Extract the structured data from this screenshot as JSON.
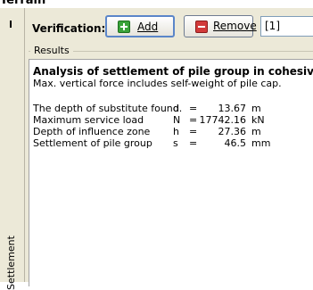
{
  "window": {
    "title_fragment": "Terrain"
  },
  "side_tab": {
    "label": "Settlement"
  },
  "toolbar": {
    "verification_label": "Verification:",
    "add_label": "Add",
    "remove_label": "Remove",
    "index_value": "[1]"
  },
  "results": {
    "legend": "Results",
    "title": "Analysis of settlement of pile group in cohesive soils",
    "subtitle": "Max. vertical force includes self-weight of pile cap.",
    "rows": [
      {
        "label": "The depth of substitute found.",
        "symbol": "d",
        "eq": "=",
        "value": "13.67",
        "unit": "m"
      },
      {
        "label": "Maximum service load",
        "symbol": "N",
        "eq": "=",
        "value": "17742.16",
        "unit": "kN"
      },
      {
        "label": "Depth of influence zone",
        "symbol": "h",
        "eq": "=",
        "value": "27.36",
        "unit": "m"
      },
      {
        "label": "Settlement of pile group",
        "symbol": "s",
        "eq": "=",
        "value": "46.5",
        "unit": "mm"
      }
    ]
  },
  "icons": {
    "add": "add-icon",
    "remove": "remove-icon"
  },
  "colors": {
    "panel_bg": "#ece9d8",
    "add_icon": "#3aa33a",
    "remove_icon": "#d23a3a",
    "focus_border": "#5b86c9"
  }
}
